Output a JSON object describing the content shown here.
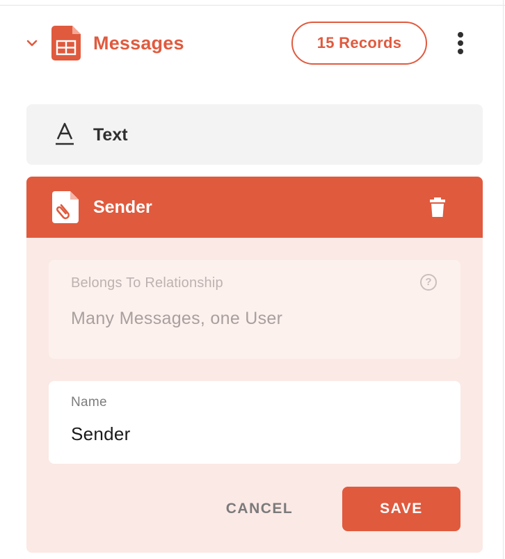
{
  "header": {
    "title": "Messages",
    "records_label": "15 Records"
  },
  "fields": {
    "text_field": {
      "label": "Text"
    },
    "sender_field": {
      "label": "Sender"
    }
  },
  "relationship": {
    "label": "Belongs To Relationship",
    "value": "Many Messages, one User"
  },
  "name_input": {
    "label": "Name",
    "value": "Sender"
  },
  "actions": {
    "cancel_label": "CANCEL",
    "save_label": "SAVE"
  },
  "icons": {
    "chevron": "chevron-down-icon",
    "table": "table-file-icon",
    "kebab": "more-vertical-icon",
    "text_type": "text-format-icon",
    "attachment": "attachment-file-icon",
    "trash": "trash-icon",
    "help": "help-circle-icon"
  },
  "colors": {
    "accent": "#e05a3e",
    "card_bg": "#fbe9e5",
    "row_bg": "#f3f3f3",
    "text_dark": "#2f2f2f"
  }
}
